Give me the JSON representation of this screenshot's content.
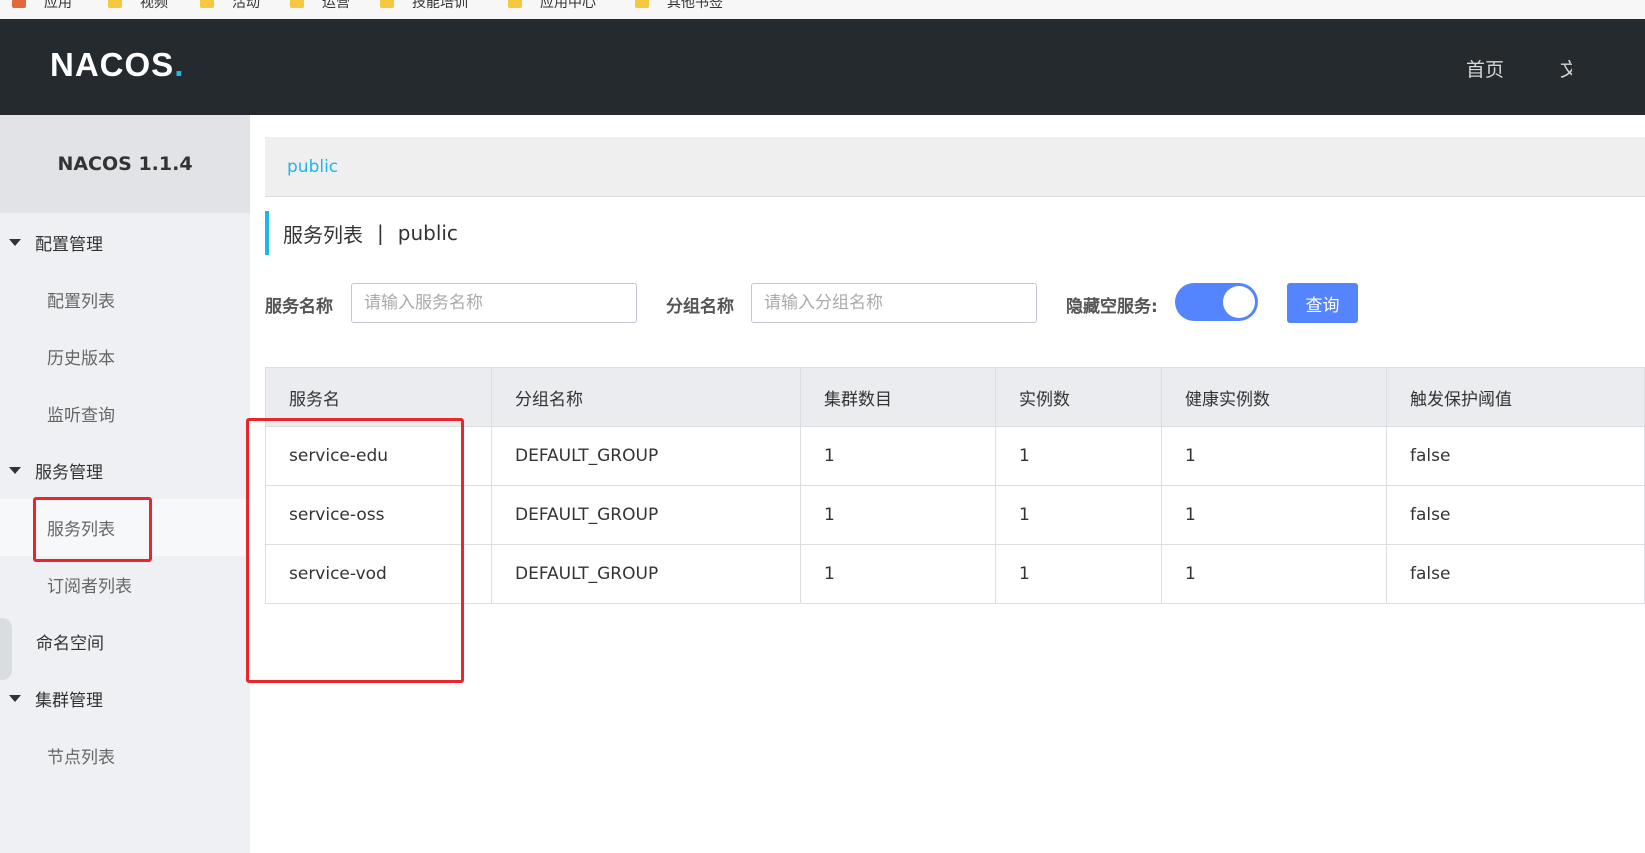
{
  "bookmarks": [
    "应用",
    "视频",
    "活动",
    "运营",
    "技能培训",
    "应用中心",
    "其他书签"
  ],
  "header": {
    "logo_text": "NACOS",
    "logo_dot": ".",
    "nav_home": "首页",
    "nav_next": "文档"
  },
  "sidebar": {
    "version": "NACOS 1.1.4",
    "config_group": "配置管理",
    "config_list": "配置列表",
    "history": "历史版本",
    "listen_query": "监听查询",
    "service_group": "服务管理",
    "service_list": "服务列表",
    "subscriber_list": "订阅者列表",
    "namespace": "命名空间",
    "cluster_group": "集群管理",
    "node_list": "节点列表"
  },
  "main": {
    "namespace_tab": "public",
    "page_title": "服务列表",
    "title_separator": "|",
    "page_namespace": "public",
    "filters": {
      "service_name_label": "服务名称",
      "service_name_placeholder": "请输入服务名称",
      "group_name_label": "分组名称",
      "group_name_placeholder": "请输入分组名称",
      "hide_empty_label": "隐藏空服务:",
      "hide_empty_on": true,
      "query_label": "查询"
    },
    "table": {
      "columns": [
        "服务名",
        "分组名称",
        "集群数目",
        "实例数",
        "健康实例数",
        "触发保护阈值"
      ],
      "rows": [
        [
          "service-edu",
          "DEFAULT_GROUP",
          "1",
          "1",
          "1",
          "false"
        ],
        [
          "service-oss",
          "DEFAULT_GROUP",
          "1",
          "1",
          "1",
          "false"
        ],
        [
          "service-vod",
          "DEFAULT_GROUP",
          "1",
          "1",
          "1",
          "false"
        ]
      ]
    }
  },
  "colors": {
    "header_bg": "#252a2f",
    "accent": "#1fb6e8",
    "primary_button": "#5584ff",
    "annotation": "#e8262b"
  }
}
